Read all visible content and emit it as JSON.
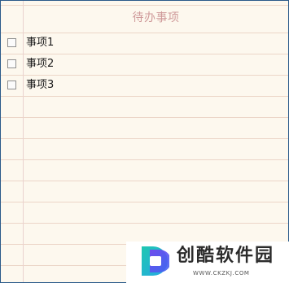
{
  "app": {
    "title": "待办事项"
  },
  "todos": [
    {
      "label": "事项1",
      "checked": false
    },
    {
      "label": "事项2",
      "checked": false
    },
    {
      "label": "事项3",
      "checked": false
    }
  ],
  "watermark": {
    "title": "创酷软件园",
    "url": "WWW.CKZKJ.COM",
    "logo_icon": "ckzkj-logo-icon",
    "colors": {
      "teal": "#1fc7b0",
      "purple": "#7a3ff2",
      "blue": "#3a66f0"
    }
  },
  "colors": {
    "paper": "#fdf8ee",
    "rule_line": "#ecd6c8",
    "title": "#cf9a9a",
    "border": "#2a5a8a"
  }
}
